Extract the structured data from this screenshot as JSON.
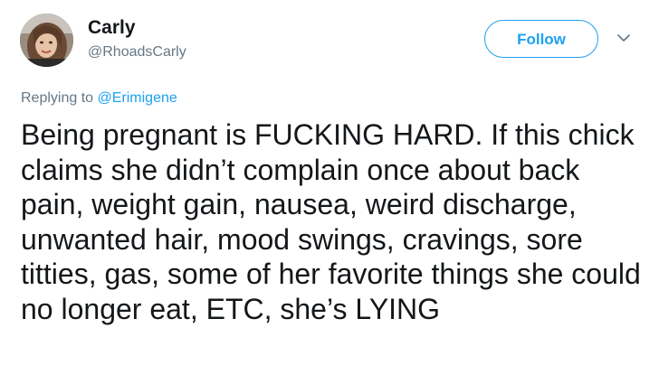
{
  "tweet": {
    "author": {
      "name": "Carly",
      "handle": "@RhoadsCarly"
    },
    "follow_label": "Follow",
    "caret_icon": "chevron-down-icon",
    "reply": {
      "prefix": "Replying to ",
      "user": "@Erimigene"
    },
    "text": "Being pregnant is FUCKING HARD. If this chick claims she didn’t complain once about back pain, weight gain, nausea, weird discharge, unwanted hair, mood swings, cravings, sore titties, gas, some of her favorite things she could no longer eat, ETC, she’s LYING"
  },
  "colors": {
    "accent": "#1da1f2",
    "secondary_text": "#657786",
    "primary_text": "#14171a"
  }
}
